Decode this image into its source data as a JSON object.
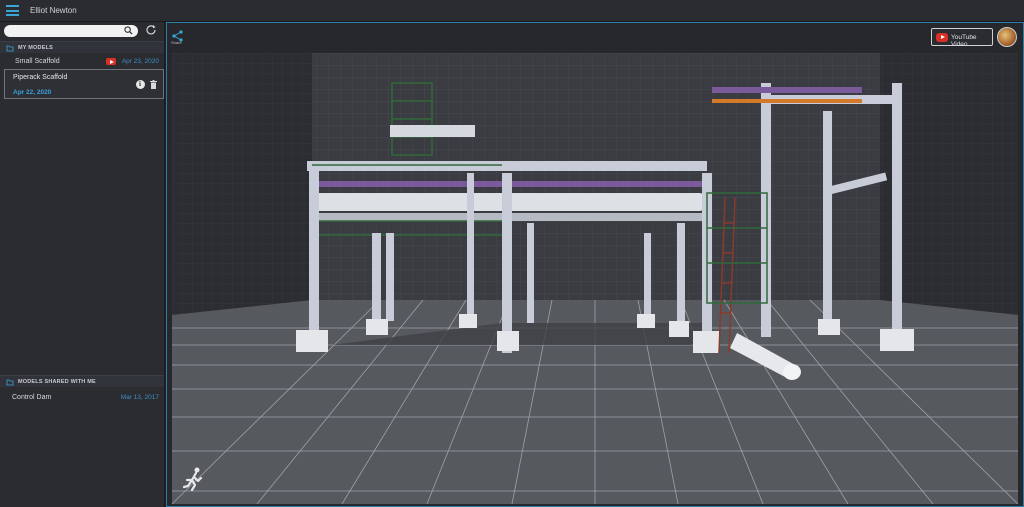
{
  "topbar": {
    "user_name": "Elliot Newton"
  },
  "search": {
    "placeholder": ""
  },
  "my_models": {
    "header": "MY MODELS",
    "items": [
      {
        "name": "Small Scaffold",
        "date": "Apr 23, 2020",
        "has_video": true
      },
      {
        "name": "Piperack Scaffold",
        "date": "Apr 22, 2020",
        "selected": true
      }
    ]
  },
  "shared_models": {
    "header": "MODELS SHARED WITH ME",
    "items": [
      {
        "name": "Control Dam",
        "date": "Mar 13, 2017"
      }
    ]
  },
  "viewer": {
    "share_label": "Share",
    "youtube_label": "YouTube Video"
  },
  "colors": {
    "accent": "#3aa6d8",
    "youtube": "#d93025",
    "steel": "#c7ccd8",
    "pipe_purple": "#7a5a9a",
    "pipe_orange": "#d27a2a",
    "scaffold_green": "#2f6a3a"
  },
  "icons": [
    "menu-icon",
    "search-icon",
    "refresh-icon",
    "folder-icon",
    "share-icon",
    "info-icon",
    "trash-icon",
    "walk-icon"
  ]
}
